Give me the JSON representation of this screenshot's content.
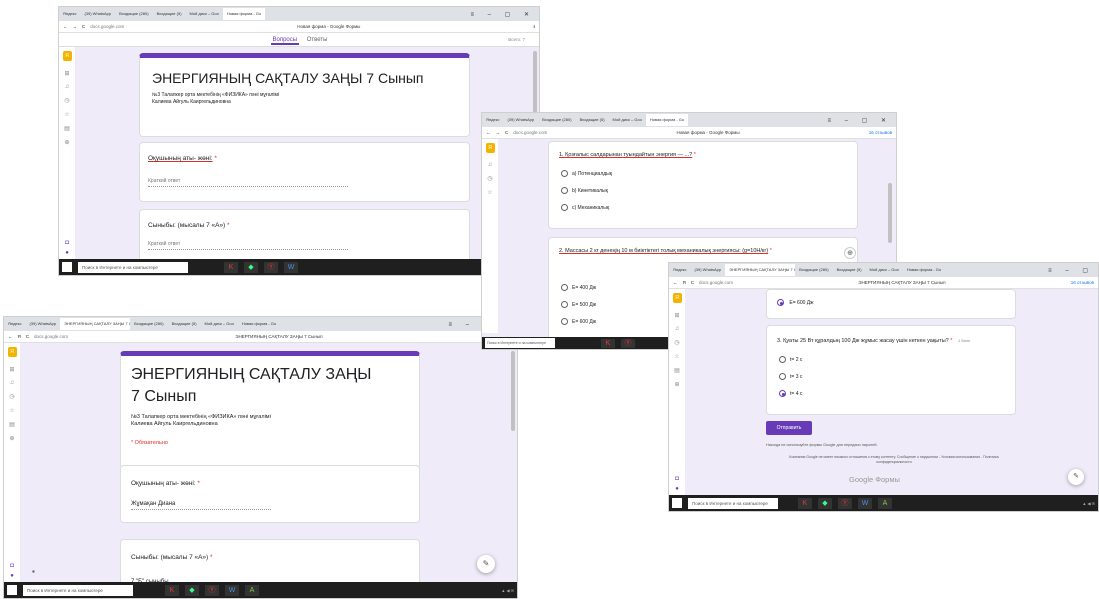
{
  "tab_titles": [
    "Яндекс",
    "(39) WhatsApp",
    "Входящие (280)",
    "Входящие (5)",
    "Мой диск – Goo",
    "Новая форма - Go"
  ],
  "shot1": {
    "tab_label": "Новая форма - Go",
    "url": "docs.google.com",
    "page_title": "Новая форма - Google Формы",
    "nav_questions": "Вопросы",
    "nav_answers": "Ответы",
    "total": "Всего: 7",
    "form_title": "ЭНЕРГИЯНЫҢ САҚТАЛУ ЗАҢЫ  7 Сынып",
    "form_desc_line1": "№3  Талапкер орта мектебінің «ФИЗИКА» пәні мұғалімі",
    "form_desc_line2": "Калиева  Айгуль Каиргельдиновна",
    "q1": "Оқушының аты- жөні:",
    "q2": "Сыныбы: (мысалы  7 «А»)",
    "required_mark": "*",
    "short_answer": "Краткий ответ",
    "taskbar_search": "Поиск в Интернете и на компьютере"
  },
  "shot2": {
    "url": "docs.google.com",
    "page_title": "Новая форма - Google Формы",
    "extension": "16 отзывов",
    "q1_text": "1.  Қозғалыс салдарынан туындайтын энергия — ...?",
    "q1_options": [
      "а) Потенциалдық",
      "b) Кинетикалық",
      "c) Механикалық"
    ],
    "q2_text": "2.  Массасы 2 кг денеңің 10 м биіктіктегі толық механикалық энергиясы: (g=10Н/кг)",
    "q2_options": [
      "Е= 400 Дж",
      "Е= 500 Дж",
      "Е= 600 Дж"
    ],
    "taskbar_search": "Поиск в Интернете и на компьютере"
  },
  "shot3": {
    "url": "docs.google.com",
    "page_title": "ЭНЕРГИЯНЫҢ САҚТАЛУ ЗАҢЫ 7 Сынып",
    "extension": "16 отзывов",
    "selected_prev": "Е= 600 Дж",
    "q3_text": "3.  Қуаты 25 Вт құралдың 100 Дж жұмыс жасау үшін кеткен уақыты?",
    "q3_points": "1 балл",
    "q3_options": [
      "t= 2 с",
      "t= 3 с",
      "t= 4 с"
    ],
    "q3_selected_index": 2,
    "submit": "Отправить",
    "note": "Никогда не используйте формы Google для передачи паролей.",
    "disclaimer": "Компания Google не имеет никакого отношения к этому контенту. Сообщение о нарушении - Условия использования - Политика конфиденциальности",
    "footer_logo": "Google Формы",
    "taskbar_search": "Поиск в Интернете и на компьютере"
  },
  "shot4": {
    "url": "docs.google.com",
    "page_title": "ЭНЕРГИЯНЫҢ САҚТАЛУ ЗАҢЫ 7 Сынып",
    "extension": "16 отзывов",
    "form_title": "ЭНЕРГИЯНЫҢ САҚТАЛУ ЗАҢЫ 7 Сынып",
    "form_desc_line1": "№3  Талапкер орта мектебінің «ФИЗИКА» пәні мұғалімі",
    "form_desc_line2": "Калиева  Айгуль Каиргельдиновна",
    "required_note": "* Обязательно",
    "q1": "Оқушының аты- жөні:",
    "q1_answer": "Жұмақан Диана",
    "q2": "Сыныбы: (мысалы 7 «А»)",
    "q2_answer": "7 \"Б\" сыныбы",
    "required_mark": "*",
    "taskbar_search": "Поиск в Интернете и на компьютере"
  },
  "colors": {
    "accent": "#673ab7",
    "required": "#d93025",
    "form_bg": "#f0ebf8"
  }
}
